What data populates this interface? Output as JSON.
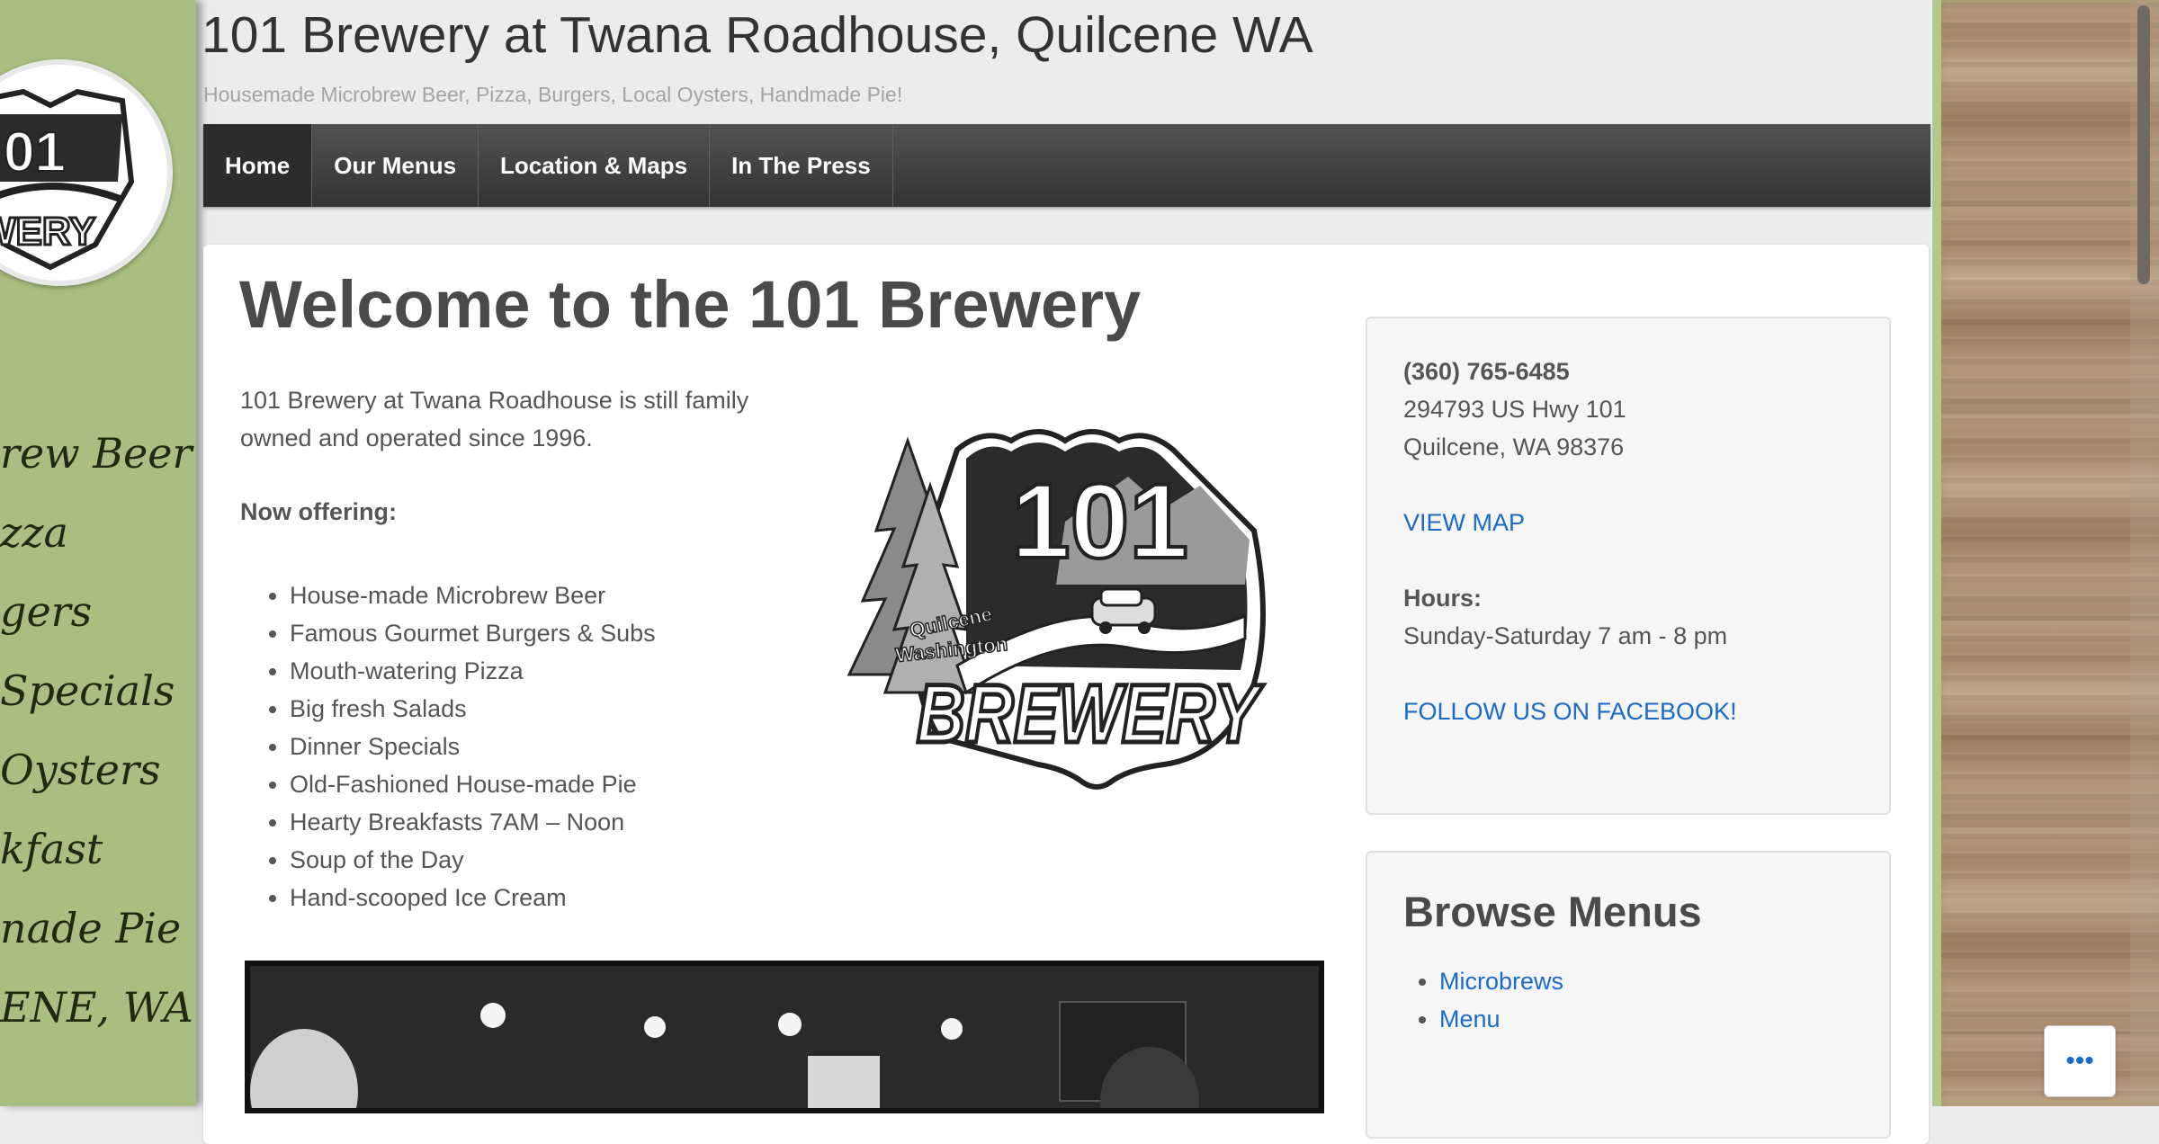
{
  "header": {
    "title": "101 Brewery at Twana Roadhouse, Quilcene WA",
    "tagline": "Housemade Microbrew Beer, Pizza, Burgers, Local Oysters, Handmade Pie!"
  },
  "nav": {
    "items": [
      {
        "label": "Home"
      },
      {
        "label": "Our Menus"
      },
      {
        "label": "Location & Maps"
      },
      {
        "label": "In The Press"
      }
    ]
  },
  "left_panel": {
    "lines": [
      "rew Beer",
      "zza",
      "gers",
      "Specials",
      "Oysters",
      "kfast",
      "nade Pie",
      "ENE, WA"
    ]
  },
  "main": {
    "heading": "Welcome to the 101 Brewery",
    "intro": "101 Brewery at Twana Roadhouse is still family owned and operated since 1996.",
    "now_offering": "Now offering:",
    "offerings": [
      "House-made Microbrew Beer",
      "Famous Gourmet Burgers & Subs",
      "Mouth-watering Pizza",
      "Big fresh Salads",
      "Dinner Specials",
      "Old-Fashioned House-made Pie",
      "Hearty Breakfasts 7AM – Noon",
      "Soup of the Day",
      "Hand-scooped Ice Cream"
    ],
    "logo_text": {
      "number": "101",
      "place_1": "Quilcene",
      "place_2": "Washington",
      "word": "BREWERY"
    }
  },
  "contact": {
    "phone": "(360) 765-6485",
    "address_1": "294793 US Hwy 101",
    "address_2": "Quilcene, WA 98376",
    "map_link": "VIEW MAP",
    "hours_label": "Hours:",
    "hours": "Sunday-Saturday 7 am - 8 pm",
    "facebook_link": "FOLLOW US ON FACEBOOK!"
  },
  "browse": {
    "title": "Browse Menus",
    "items": [
      "Microbrews",
      "Menu"
    ]
  },
  "more_button": {
    "label": "•••"
  },
  "colors": {
    "link": "#1b6ac9",
    "nav_bg": "#3d3d3d",
    "left_panel": "#a9bf81",
    "heading": "#4a4a4a"
  }
}
